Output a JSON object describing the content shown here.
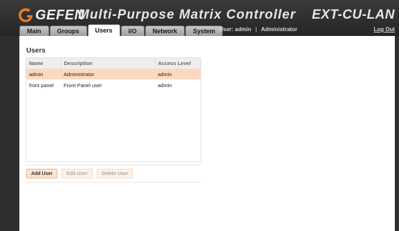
{
  "header": {
    "logo_text": "GEFEN",
    "app_title": "Multi-Purpose Matrix Controller",
    "model": "EXT-CU-LAN"
  },
  "tabs": [
    {
      "label": "Main"
    },
    {
      "label": "Groups"
    },
    {
      "label": "Users",
      "active": true
    },
    {
      "label": "I/O"
    },
    {
      "label": "Network"
    },
    {
      "label": "System"
    }
  ],
  "session": {
    "user_label": "User: admin",
    "role": "Administrator",
    "logout_label": "Log Out"
  },
  "users": {
    "title": "Users",
    "columns": [
      "Name",
      "Description",
      "Access Level"
    ],
    "rows": [
      {
        "name": "admin",
        "description": "Administrator",
        "access": "admin",
        "selected": true
      },
      {
        "name": "front panel",
        "description": "Front Panel user",
        "access": "admin"
      }
    ],
    "buttons": {
      "add": "Add User",
      "edit": "Edit User",
      "delete": "Delete User"
    }
  },
  "colors": {
    "accent_orange": "#f07a1d",
    "selected_row": "#fbd9c0",
    "header_bg": "#2e2e2e"
  }
}
